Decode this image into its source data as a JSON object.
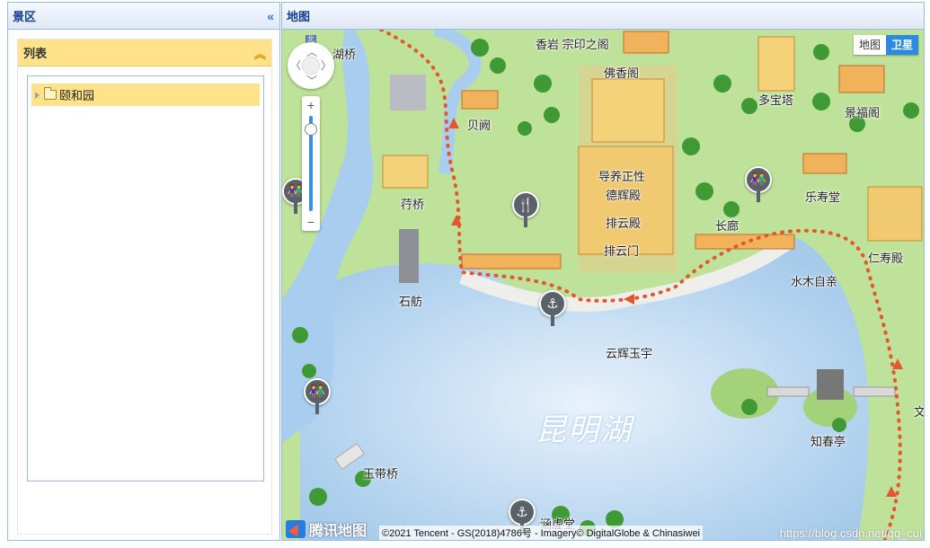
{
  "left_panel": {
    "title": "景区",
    "collapse_icon": "double-chevron-left-icon",
    "list": {
      "title": "列表",
      "fold_icon": "double-chevron-up-icon",
      "tree": [
        {
          "label": "颐和园",
          "expanded": false
        }
      ]
    }
  },
  "map_panel": {
    "title": "地图",
    "map_type": {
      "map": "地图",
      "satellite": "卫星",
      "selected": "卫星"
    },
    "lake_label": "昆明湖",
    "places": [
      "香岩 宗印之阁",
      "佛香阁",
      "多宝塔",
      "景福阁",
      "贝阙",
      "导养正性",
      "德辉殿",
      "排云殿",
      "排云门",
      "长廊",
      "乐寿堂",
      "仁寿殿",
      "水木自亲",
      "荇桥",
      "石舫",
      "云辉玉宇",
      "知春亭",
      "玉带桥",
      "涵虚堂",
      "文",
      "湖桥"
    ],
    "nav": {
      "compass": "北",
      "zoom_in": "+",
      "zoom_out": "−"
    },
    "logo_text": "腾讯地图",
    "copyright": "©2021 Tencent - GS(2018)4786号 - Imagery© DigitalGlobe & Chinasiwei",
    "watermark": "https://blog.csdn.net/qq_cui"
  }
}
